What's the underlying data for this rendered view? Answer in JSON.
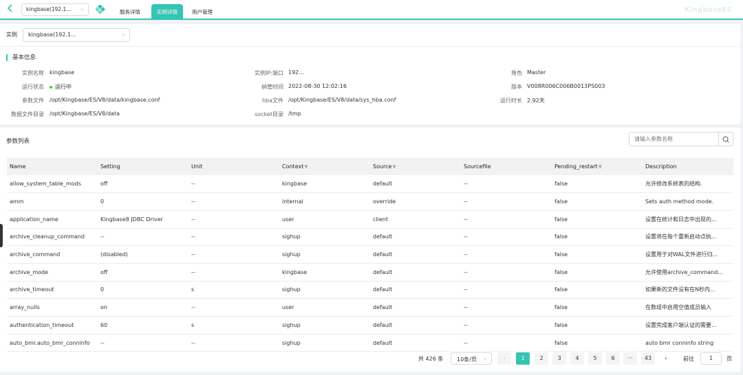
{
  "header": {
    "instance_select": "kingbase(192.1...",
    "tabs": [
      "服务详情",
      "实例详情",
      "用户管理"
    ],
    "active_tab": "实例详情",
    "brand": "KingbaseES",
    "accent_color": "#36c4b3"
  },
  "instance_row": {
    "label": "实例",
    "value": "kingbase(192.1..."
  },
  "basic_info": {
    "title": "基本信息",
    "rows": [
      [
        {
          "label": "实例名称",
          "value": "kingbase"
        },
        {
          "label": "实例IP:端口",
          "value": "192..."
        },
        {
          "label": "角色",
          "value": "Master"
        }
      ],
      [
        {
          "label": "运行状态",
          "value": "运行中"
        },
        {
          "label": "纳管时间",
          "value": "2022-08-30 12:02:16"
        },
        {
          "label": "版本",
          "value": "V008R006C006B0013PS003"
        }
      ],
      [
        {
          "label": "参数文件",
          "value": "/opt/Kingbase/ES/V8/data/kingbase.conf"
        },
        {
          "label": "hba文件",
          "value": "/opt/Kingbase/ES/V8/data/sys_hba.conf"
        },
        {
          "label": "运行时长",
          "value": "2.92天"
        }
      ],
      [
        {
          "label": "数据文件目录",
          "value": "/opt/Kingbase/ES/V8/data"
        },
        {
          "label": "socket目录",
          "value": "/tmp"
        }
      ]
    ]
  },
  "params": {
    "title": "参数列表",
    "search_placeholder": "请输入参数名称",
    "columns": [
      "Name",
      "Setting",
      "Unit",
      "Context",
      "Source",
      "Sourcefile",
      "Pending_restart",
      "Description"
    ],
    "filter_columns": [
      "Context",
      "Source",
      "Pending_restart"
    ],
    "rows": [
      [
        "allow_system_table_mods",
        "off",
        "--",
        "kingbase",
        "default",
        "--",
        "false",
        "允许修改系统表的结构."
      ],
      [
        "amm",
        "0",
        "--",
        "internal",
        "override",
        "--",
        "false",
        "Sets auth method mode."
      ],
      [
        "application_name",
        "Kingbase8 JDBC Driver",
        "--",
        "user",
        "client",
        "--",
        "false",
        "设置在统计和日志中出现的..."
      ],
      [
        "archive_cleanup_command",
        "--",
        "--",
        "sighup",
        "default",
        "--",
        "false",
        "设置将在每个重新启动点执..."
      ],
      [
        "archive_command",
        "(disabled)",
        "--",
        "sighup",
        "default",
        "--",
        "false",
        "设置用于对WAL文件进行归..."
      ],
      [
        "archive_mode",
        "off",
        "--",
        "kingbase",
        "default",
        "--",
        "false",
        "允许使用archive_command..."
      ],
      [
        "archive_timeout",
        "0",
        "s",
        "sighup",
        "default",
        "--",
        "false",
        "如果新的文件没有在N秒内..."
      ],
      [
        "array_nulls",
        "on",
        "--",
        "user",
        "default",
        "--",
        "false",
        "在数组中启用空值成员输入"
      ],
      [
        "authentication_timeout",
        "60",
        "s",
        "sighup",
        "default",
        "--",
        "false",
        "设置完成客户端认证的需要..."
      ],
      [
        "auto_bmr.auto_bmr_conninfo",
        "--",
        "--",
        "sighup",
        "default",
        "--",
        "false",
        "auto bmr conninfo string"
      ]
    ]
  },
  "pagination": {
    "total": "共 426 条",
    "page_size": "10条/页",
    "pages": [
      "1",
      "2",
      "3",
      "4",
      "5",
      "6",
      "···",
      "43"
    ],
    "current": "1",
    "goto_label": "前往",
    "goto_value": "1",
    "goto_suffix": "页"
  }
}
